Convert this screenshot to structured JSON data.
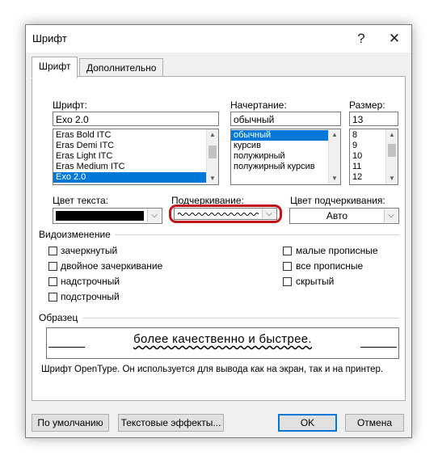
{
  "window": {
    "title": "Шрифт",
    "help_glyph": "?",
    "close_glyph": "✕"
  },
  "tabs": [
    {
      "label": "Шрифт"
    },
    {
      "label": "Дополнительно"
    }
  ],
  "font": {
    "label": "Шрифт:",
    "value": "Exo 2.0",
    "items": [
      "Eras Bold ITC",
      "Eras Demi ITC",
      "Eras Light ITC",
      "Eras Medium ITC",
      "Exo 2.0"
    ],
    "selected_index": 4
  },
  "style": {
    "label": "Начертание:",
    "value": "обычный",
    "items": [
      "обычный",
      "курсив",
      "полужирный",
      "полужирный курсив"
    ],
    "selected_index": 0
  },
  "size": {
    "label": "Размер:",
    "value": "13",
    "items": [
      "8",
      "9",
      "10",
      "11",
      "12"
    ]
  },
  "text_color": {
    "label": "Цвет текста:",
    "color": "#000000"
  },
  "underline": {
    "label": "Подчеркивание:",
    "highlight_color": "#c0151b"
  },
  "underline_color": {
    "label": "Цвет подчеркивания:",
    "value": "Авто"
  },
  "effects": {
    "heading": "Видоизменение",
    "left": [
      "зачеркнутый",
      "двойное зачеркивание",
      "надстрочный",
      "подстрочный"
    ],
    "right": [
      "малые прописные",
      "все прописные",
      "скрытый"
    ]
  },
  "preview": {
    "heading": "Образец",
    "text": "более качественно и быстрее.",
    "note": "Шрифт OpenType. Он используется для вывода как на экран, так и на принтер."
  },
  "buttons": {
    "default": "По умолчанию",
    "text_effects": "Текстовые эффекты...",
    "ok": "OK",
    "cancel": "Отмена"
  },
  "icons": {
    "arrow_up": "▲",
    "arrow_down": "▼",
    "chevron_down": "⌵"
  }
}
